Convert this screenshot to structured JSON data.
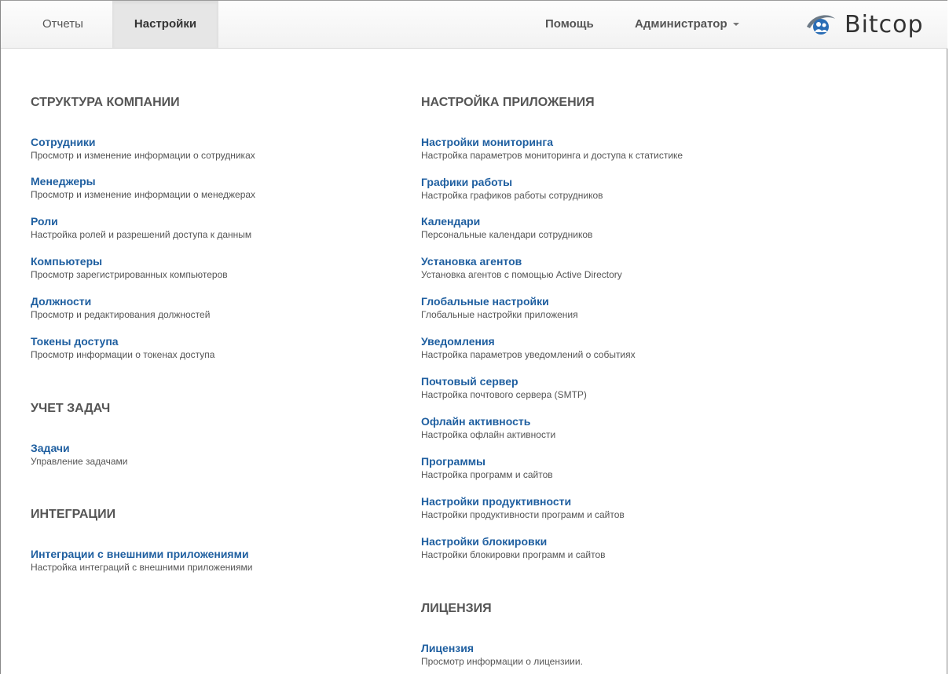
{
  "nav": {
    "reports": "Отчеты",
    "settings": "Настройки",
    "help": "Помощь",
    "admin": "Администратор",
    "logo_text": "Bitcop"
  },
  "colors": {
    "link": "#1f5fa0",
    "heading": "#555555",
    "logo_blue": "#2a6db5"
  },
  "left": {
    "company": {
      "title": "СТРУКТУРА КОМПАНИИ",
      "items": [
        {
          "title": "Сотрудники",
          "desc": "Просмотр и изменение информации о сотрудниках"
        },
        {
          "title": "Менеджеры",
          "desc": "Просмотр и изменение информации о менеджерах"
        },
        {
          "title": "Роли",
          "desc": "Настройка ролей и разрешений доступа к данным"
        },
        {
          "title": "Компьютеры",
          "desc": "Просмотр зарегистрированных компьютеров"
        },
        {
          "title": "Должности",
          "desc": "Просмотр и редактирования должностей"
        },
        {
          "title": "Токены доступа",
          "desc": "Просмотр информации о токенах доступа"
        }
      ]
    },
    "tasks": {
      "title": "УЧЕТ ЗАДАЧ",
      "items": [
        {
          "title": "Задачи",
          "desc": "Управление задачами"
        }
      ]
    },
    "integrations": {
      "title": "ИНТЕГРАЦИИ",
      "items": [
        {
          "title": "Интеграции с внешними приложениями",
          "desc": "Настройка интеграций с внешними приложениями"
        }
      ]
    }
  },
  "right": {
    "app": {
      "title": "НАСТРОЙКА ПРИЛОЖЕНИЯ",
      "items": [
        {
          "title": "Настройки мониторинга",
          "desc": "Настройка параметров мониторинга и доступа к статистике"
        },
        {
          "title": "Графики работы",
          "desc": "Настройка графиков работы сотрудников"
        },
        {
          "title": "Календари",
          "desc": "Персональные календари сотрудников"
        },
        {
          "title": "Установка агентов",
          "desc": "Установка агентов с помощью Active Directory"
        },
        {
          "title": "Глобальные настройки",
          "desc": "Глобальные настройки приложения"
        },
        {
          "title": "Уведомления",
          "desc": "Настройка параметров уведомлений о событиях"
        },
        {
          "title": "Почтовый сервер",
          "desc": "Настройка почтового сервера (SMTP)"
        },
        {
          "title": "Офлайн активность",
          "desc": "Настройка офлайн активности"
        },
        {
          "title": "Программы",
          "desc": "Настройка программ и сайтов"
        },
        {
          "title": "Настройки продуктивности",
          "desc": "Настройки продуктивности программ и сайтов"
        },
        {
          "title": "Настройки блокировки",
          "desc": "Настройки блокировки программ и сайтов"
        }
      ]
    },
    "license": {
      "title": "ЛИЦЕНЗИЯ",
      "items": [
        {
          "title": "Лицензия",
          "desc": "Просмотр информации о лицензиии."
        }
      ]
    }
  }
}
